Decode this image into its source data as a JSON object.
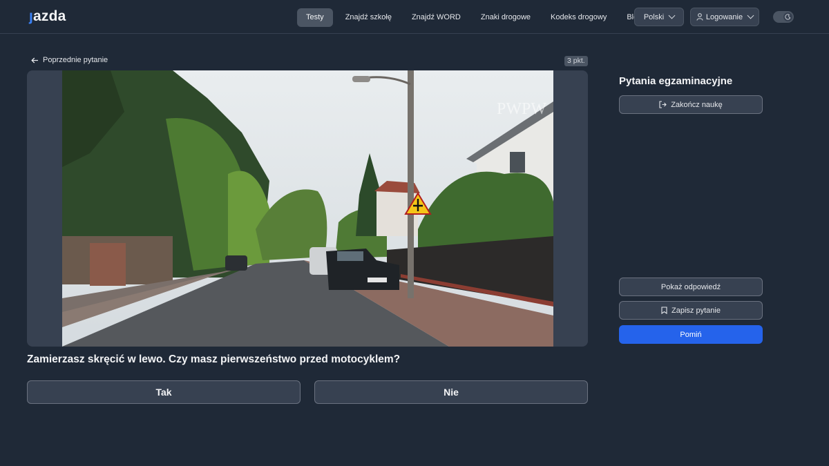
{
  "header": {
    "logo": "jazda",
    "nav": [
      "Testy",
      "Znajdź szkołę",
      "Znajdź WORD",
      "Znaki drogowe",
      "Kodeks drogowy",
      "Blog"
    ],
    "active_nav": "Testy",
    "language": "Polski",
    "login": "Logowanie",
    "theme_toggle_icon": "moon-icon"
  },
  "question": {
    "prev_label": "Poprzednie pytanie",
    "points": "3 pkt.",
    "text": "Zamierzasz skręcić w lewo. Czy masz pierwszeństwo przed motocyklem?",
    "answers": [
      "Tak",
      "Nie"
    ],
    "media_watermark": "PWPW",
    "sign_icon": "crossroads-priority-sign-icon"
  },
  "sidebar": {
    "title": "Pytania egzaminacyjne",
    "finish": "Zakończ naukę",
    "show_answer": "Pokaż odpowiedź",
    "save": "Zapisz pytanie",
    "skip": "Pomiń"
  },
  "colors": {
    "background": "#1f2937",
    "surface": "#374151",
    "primary": "#2563eb"
  }
}
